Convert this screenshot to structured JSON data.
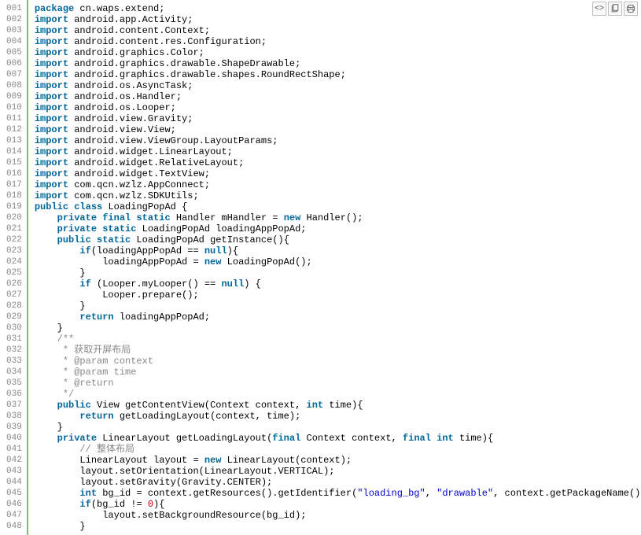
{
  "toolbar": {
    "view_source": "view source",
    "copy": "copy to clipboard",
    "print": "print"
  },
  "lines": [
    {
      "n": "001",
      "tokens": [
        {
          "t": "package ",
          "c": "kw"
        },
        {
          "t": "cn.waps.extend;",
          "c": "plain"
        }
      ]
    },
    {
      "n": "002",
      "tokens": [
        {
          "t": "import ",
          "c": "kw"
        },
        {
          "t": "android.app.Activity;",
          "c": "plain"
        }
      ]
    },
    {
      "n": "003",
      "tokens": [
        {
          "t": "import ",
          "c": "kw"
        },
        {
          "t": "android.content.Context;",
          "c": "plain"
        }
      ]
    },
    {
      "n": "004",
      "tokens": [
        {
          "t": "import ",
          "c": "kw"
        },
        {
          "t": "android.content.res.Configuration;",
          "c": "plain"
        }
      ]
    },
    {
      "n": "005",
      "tokens": [
        {
          "t": "import ",
          "c": "kw"
        },
        {
          "t": "android.graphics.Color;",
          "c": "plain"
        }
      ]
    },
    {
      "n": "006",
      "tokens": [
        {
          "t": "import ",
          "c": "kw"
        },
        {
          "t": "android.graphics.drawable.ShapeDrawable;",
          "c": "plain"
        }
      ]
    },
    {
      "n": "007",
      "tokens": [
        {
          "t": "import ",
          "c": "kw"
        },
        {
          "t": "android.graphics.drawable.shapes.RoundRectShape;",
          "c": "plain"
        }
      ]
    },
    {
      "n": "008",
      "tokens": [
        {
          "t": "import ",
          "c": "kw"
        },
        {
          "t": "android.os.AsyncTask;",
          "c": "plain"
        }
      ]
    },
    {
      "n": "009",
      "tokens": [
        {
          "t": "import ",
          "c": "kw"
        },
        {
          "t": "android.os.Handler;",
          "c": "plain"
        }
      ]
    },
    {
      "n": "010",
      "tokens": [
        {
          "t": "import ",
          "c": "kw"
        },
        {
          "t": "android.os.Looper;",
          "c": "plain"
        }
      ]
    },
    {
      "n": "011",
      "tokens": [
        {
          "t": "import ",
          "c": "kw"
        },
        {
          "t": "android.view.Gravity;",
          "c": "plain"
        }
      ]
    },
    {
      "n": "012",
      "tokens": [
        {
          "t": "import ",
          "c": "kw"
        },
        {
          "t": "android.view.View;",
          "c": "plain"
        }
      ]
    },
    {
      "n": "013",
      "tokens": [
        {
          "t": "import ",
          "c": "kw"
        },
        {
          "t": "android.view.ViewGroup.LayoutParams;",
          "c": "plain"
        }
      ]
    },
    {
      "n": "014",
      "tokens": [
        {
          "t": "import ",
          "c": "kw"
        },
        {
          "t": "android.widget.LinearLayout;",
          "c": "plain"
        }
      ]
    },
    {
      "n": "015",
      "tokens": [
        {
          "t": "import ",
          "c": "kw"
        },
        {
          "t": "android.widget.RelativeLayout;",
          "c": "plain"
        }
      ]
    },
    {
      "n": "016",
      "tokens": [
        {
          "t": "import ",
          "c": "kw"
        },
        {
          "t": "android.widget.TextView;",
          "c": "plain"
        }
      ]
    },
    {
      "n": "017",
      "tokens": [
        {
          "t": "import ",
          "c": "kw"
        },
        {
          "t": "com.qcn.wzlz.AppConnect;",
          "c": "plain"
        }
      ]
    },
    {
      "n": "018",
      "tokens": [
        {
          "t": "import ",
          "c": "kw"
        },
        {
          "t": "com.qcn.wzlz.SDKUtils;",
          "c": "plain"
        }
      ]
    },
    {
      "n": "019",
      "tokens": [
        {
          "t": "public ",
          "c": "kw"
        },
        {
          "t": "class ",
          "c": "kw"
        },
        {
          "t": "LoadingPopAd {",
          "c": "plain"
        }
      ]
    },
    {
      "n": "020",
      "tokens": [
        {
          "t": "    ",
          "c": "plain"
        },
        {
          "t": "private ",
          "c": "kw"
        },
        {
          "t": "final ",
          "c": "kw"
        },
        {
          "t": "static ",
          "c": "kw"
        },
        {
          "t": "Handler mHandler = ",
          "c": "plain"
        },
        {
          "t": "new ",
          "c": "kw"
        },
        {
          "t": "Handler();",
          "c": "plain"
        }
      ]
    },
    {
      "n": "021",
      "tokens": [
        {
          "t": "    ",
          "c": "plain"
        },
        {
          "t": "private ",
          "c": "kw"
        },
        {
          "t": "static ",
          "c": "kw"
        },
        {
          "t": "LoadingPopAd loadingAppPopAd;",
          "c": "plain"
        }
      ]
    },
    {
      "n": "022",
      "tokens": [
        {
          "t": "    ",
          "c": "plain"
        },
        {
          "t": "public ",
          "c": "kw"
        },
        {
          "t": "static ",
          "c": "kw"
        },
        {
          "t": "LoadingPopAd getInstance(){",
          "c": "plain"
        }
      ]
    },
    {
      "n": "023",
      "tokens": [
        {
          "t": "        ",
          "c": "plain"
        },
        {
          "t": "if",
          "c": "kw"
        },
        {
          "t": "(loadingAppPopAd == ",
          "c": "plain"
        },
        {
          "t": "null",
          "c": "kw"
        },
        {
          "t": "){",
          "c": "plain"
        }
      ]
    },
    {
      "n": "024",
      "tokens": [
        {
          "t": "            loadingAppPopAd = ",
          "c": "plain"
        },
        {
          "t": "new ",
          "c": "kw"
        },
        {
          "t": "LoadingPopAd();",
          "c": "plain"
        }
      ]
    },
    {
      "n": "025",
      "tokens": [
        {
          "t": "        }",
          "c": "plain"
        }
      ]
    },
    {
      "n": "026",
      "tokens": [
        {
          "t": "        ",
          "c": "plain"
        },
        {
          "t": "if ",
          "c": "kw"
        },
        {
          "t": "(Looper.myLooper() == ",
          "c": "plain"
        },
        {
          "t": "null",
          "c": "kw"
        },
        {
          "t": ") {",
          "c": "plain"
        }
      ]
    },
    {
      "n": "027",
      "tokens": [
        {
          "t": "            Looper.prepare();",
          "c": "plain"
        }
      ]
    },
    {
      "n": "028",
      "tokens": [
        {
          "t": "        }",
          "c": "plain"
        }
      ]
    },
    {
      "n": "029",
      "tokens": [
        {
          "t": "        ",
          "c": "plain"
        },
        {
          "t": "return ",
          "c": "kw"
        },
        {
          "t": "loadingAppPopAd;",
          "c": "plain"
        }
      ]
    },
    {
      "n": "030",
      "tokens": [
        {
          "t": "    }",
          "c": "plain"
        }
      ]
    },
    {
      "n": "031",
      "tokens": [
        {
          "t": "    /**",
          "c": "comment"
        }
      ]
    },
    {
      "n": "032",
      "tokens": [
        {
          "t": "     * 获取开屏布局",
          "c": "comment"
        }
      ]
    },
    {
      "n": "033",
      "tokens": [
        {
          "t": "     * @param context",
          "c": "comment"
        }
      ]
    },
    {
      "n": "034",
      "tokens": [
        {
          "t": "     * @param time",
          "c": "comment"
        }
      ]
    },
    {
      "n": "035",
      "tokens": [
        {
          "t": "     * @return",
          "c": "comment"
        }
      ]
    },
    {
      "n": "036",
      "tokens": [
        {
          "t": "     */",
          "c": "comment"
        }
      ]
    },
    {
      "n": "037",
      "tokens": [
        {
          "t": "    ",
          "c": "plain"
        },
        {
          "t": "public ",
          "c": "kw"
        },
        {
          "t": "View getContentView(Context context, ",
          "c": "plain"
        },
        {
          "t": "int ",
          "c": "kw"
        },
        {
          "t": "time){",
          "c": "plain"
        }
      ]
    },
    {
      "n": "038",
      "tokens": [
        {
          "t": "        ",
          "c": "plain"
        },
        {
          "t": "return ",
          "c": "kw"
        },
        {
          "t": "getLoadingLayout(context, time);",
          "c": "plain"
        }
      ]
    },
    {
      "n": "039",
      "tokens": [
        {
          "t": "    }",
          "c": "plain"
        }
      ]
    },
    {
      "n": "040",
      "tokens": [
        {
          "t": "    ",
          "c": "plain"
        },
        {
          "t": "private ",
          "c": "kw"
        },
        {
          "t": "LinearLayout getLoadingLayout(",
          "c": "plain"
        },
        {
          "t": "final ",
          "c": "kw"
        },
        {
          "t": "Context context, ",
          "c": "plain"
        },
        {
          "t": "final ",
          "c": "kw"
        },
        {
          "t": "int ",
          "c": "kw"
        },
        {
          "t": "time){",
          "c": "plain"
        }
      ]
    },
    {
      "n": "041",
      "tokens": [
        {
          "t": "        ",
          "c": "plain"
        },
        {
          "t": "// 整体布局",
          "c": "comment"
        }
      ]
    },
    {
      "n": "042",
      "tokens": [
        {
          "t": "        LinearLayout layout = ",
          "c": "plain"
        },
        {
          "t": "new ",
          "c": "kw"
        },
        {
          "t": "LinearLayout(context);",
          "c": "plain"
        }
      ]
    },
    {
      "n": "043",
      "tokens": [
        {
          "t": "        layout.setOrientation(LinearLayout.VERTICAL);",
          "c": "plain"
        }
      ]
    },
    {
      "n": "044",
      "tokens": [
        {
          "t": "        layout.setGravity(Gravity.CENTER);",
          "c": "plain"
        }
      ]
    },
    {
      "n": "045",
      "tokens": [
        {
          "t": "        ",
          "c": "plain"
        },
        {
          "t": "int ",
          "c": "kw"
        },
        {
          "t": "bg_id = context.getResources().getIdentifier(",
          "c": "plain"
        },
        {
          "t": "\"loading_bg\"",
          "c": "str"
        },
        {
          "t": ", ",
          "c": "plain"
        },
        {
          "t": "\"drawable\"",
          "c": "str"
        },
        {
          "t": ", context.getPackageName());",
          "c": "plain"
        }
      ]
    },
    {
      "n": "046",
      "tokens": [
        {
          "t": "        ",
          "c": "plain"
        },
        {
          "t": "if",
          "c": "kw"
        },
        {
          "t": "(bg_id != ",
          "c": "plain"
        },
        {
          "t": "0",
          "c": "num"
        },
        {
          "t": "){",
          "c": "plain"
        }
      ]
    },
    {
      "n": "047",
      "tokens": [
        {
          "t": "            layout.setBackgroundResource(bg_id);",
          "c": "plain"
        }
      ]
    },
    {
      "n": "048",
      "tokens": [
        {
          "t": "        }",
          "c": "plain"
        }
      ]
    }
  ]
}
